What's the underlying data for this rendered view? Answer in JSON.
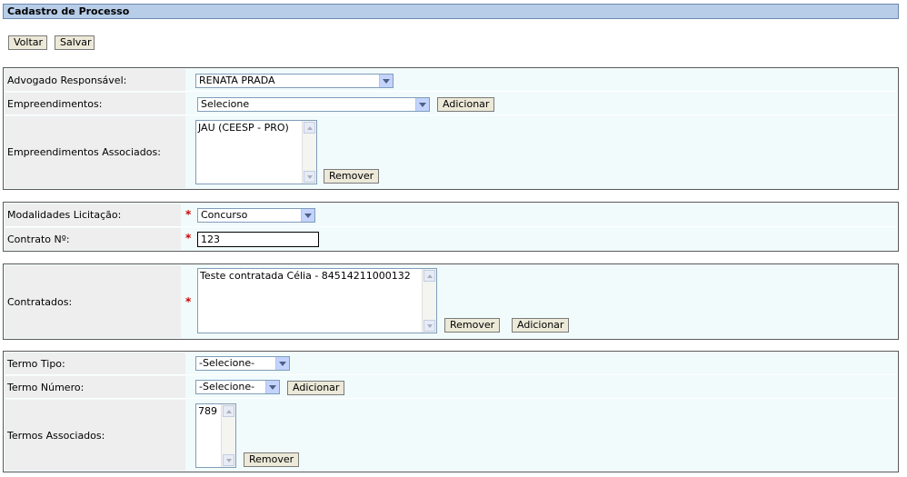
{
  "header": {
    "title": "Cadastro de Processo"
  },
  "toolbar": {
    "back_label": "Voltar",
    "save_label": "Salvar"
  },
  "section1": {
    "advogado_label": "Advogado Responsável:",
    "advogado_value": "RENATA PRADA",
    "empreendimentos_label": "Empreendimentos:",
    "empreendimentos_value": "Selecione",
    "adicionar_label": "Adicionar",
    "associados_label": "Empreendimentos Associados:",
    "associados_items": [
      "JAU (CEESP - PRO)"
    ],
    "remover_label": "Remover"
  },
  "section2": {
    "modalidades_label": "Modalidades Licitação:",
    "modalidades_value": "Concurso",
    "contrato_label": "Contrato Nº:",
    "contrato_value": "123",
    "required_mark": "*"
  },
  "section3": {
    "contratados_label": "Contratados:",
    "contratados_items": [
      "Teste contratada Célia - 84514211000132"
    ],
    "remover_label": "Remover",
    "adicionar_label": "Adicionar",
    "required_mark": "*"
  },
  "section4": {
    "termo_tipo_label": "Termo Tipo:",
    "termo_tipo_value": "-Selecione-",
    "termo_numero_label": "Termo Número:",
    "termo_numero_value": "-Selecione-",
    "adicionar_label": "Adicionar",
    "termos_associados_label": "Termos Associados:",
    "termos_associados_items": [
      "789"
    ],
    "remover_label": "Remover"
  }
}
